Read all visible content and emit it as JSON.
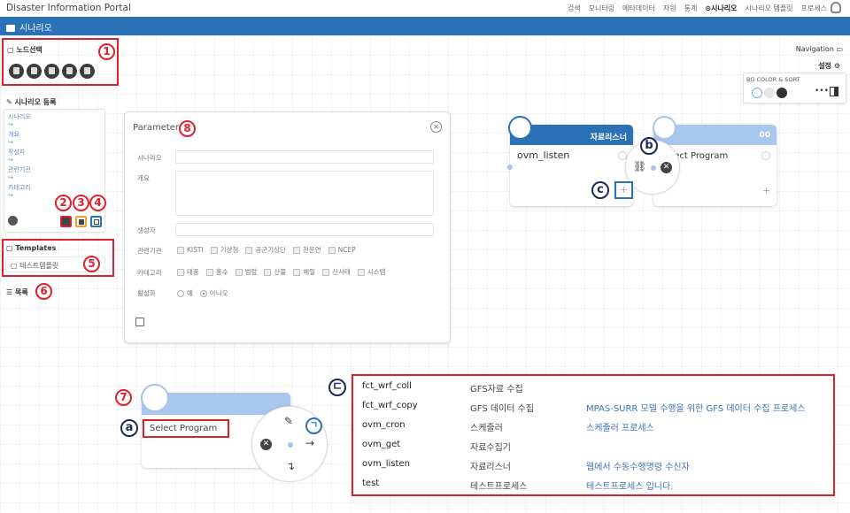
{
  "app": {
    "title": "Disaster Information Portal",
    "nav": [
      "검색",
      "모니터링",
      "메타데이터",
      "자원",
      "통계",
      "시나리오",
      "시나리오 템플릿",
      "프로세스"
    ],
    "nav_active": "시나리오",
    "page_title": "시나리오"
  },
  "colors": {
    "header": "#2a72b5",
    "annotation_red": "#e0202a",
    "annotation_navy": "#1c2a55",
    "link": "#3a73b5"
  },
  "node_select": {
    "label": "노드선택",
    "icons": [
      "document-icon",
      "sign-in-icon",
      "copy-icon",
      "industry-icon",
      "clone-icon"
    ]
  },
  "scenario_register": {
    "label": "시나리오 등록",
    "fields": [
      {
        "label": "시나리오",
        "value": "↪"
      },
      {
        "label": "개요",
        "value": "↪"
      },
      {
        "label": "작성자",
        "value": "↪"
      },
      {
        "label": "관련기관",
        "value": "↪"
      },
      {
        "label": "카테고리",
        "value": "↪"
      }
    ]
  },
  "templates": {
    "label": "Templates",
    "items": [
      "테스트템플릿"
    ]
  },
  "list_label": "목록",
  "annotations": {
    "n1": "1",
    "n2": "2",
    "n3": "3",
    "n4": "4",
    "n5": "5",
    "n6": "6",
    "n7": "7",
    "n8": "8",
    "a": "a",
    "b": "b",
    "c": "c",
    "giyeok": "ㄱ",
    "digeut": "ㄷ"
  },
  "parameter": {
    "title": "Parameter",
    "fields": {
      "scenario": {
        "label": "시나리오",
        "value": ""
      },
      "summary": {
        "label": "개요",
        "value": ""
      },
      "author": {
        "label": "생성자",
        "value": ""
      }
    },
    "org_label": "관련기관",
    "orgs": [
      "KISTI",
      "기상청",
      "공군기상단",
      "천문연",
      "NCEP"
    ],
    "category_label": "카테고리",
    "categories": [
      "태풍",
      "홍수",
      "범람",
      "산불",
      "해일",
      "산사태",
      "시스템"
    ],
    "active_label": "활성화",
    "active_options": [
      "예",
      "아니오"
    ],
    "active_selected": "아니오"
  },
  "right_panel": {
    "navigation": "Navigation",
    "settings": "설정",
    "bg_label": "BG COLOR & SORT",
    "more": "•••"
  },
  "nodes": {
    "listen": {
      "title": "자료리스너",
      "name": "ovm_listen"
    },
    "select_top": {
      "title": "00",
      "name": "Select Program"
    },
    "select_bottom": {
      "title": "",
      "name": "Select Program"
    }
  },
  "processes": [
    {
      "id": "fct_wrf_coll",
      "name": "GFS자료 수집",
      "desc": ""
    },
    {
      "id": "fct_wrf_copy",
      "name": "GFS 데이터 수집",
      "desc": "MPAS-SURR 모델 수행을 위한 GFS 데이터 수집 프로세스"
    },
    {
      "id": "ovm_cron",
      "name": "스케줄러",
      "desc": "스케줄러 프로세스"
    },
    {
      "id": "ovm_get",
      "name": "자료수집기",
      "desc": ""
    },
    {
      "id": "ovm_listen",
      "name": "자료리스너",
      "desc": "웹에서 수동수행명령 수신자"
    },
    {
      "id": "test",
      "name": "테스트프로세스",
      "desc": "테스트프로세스 입니다."
    }
  ]
}
